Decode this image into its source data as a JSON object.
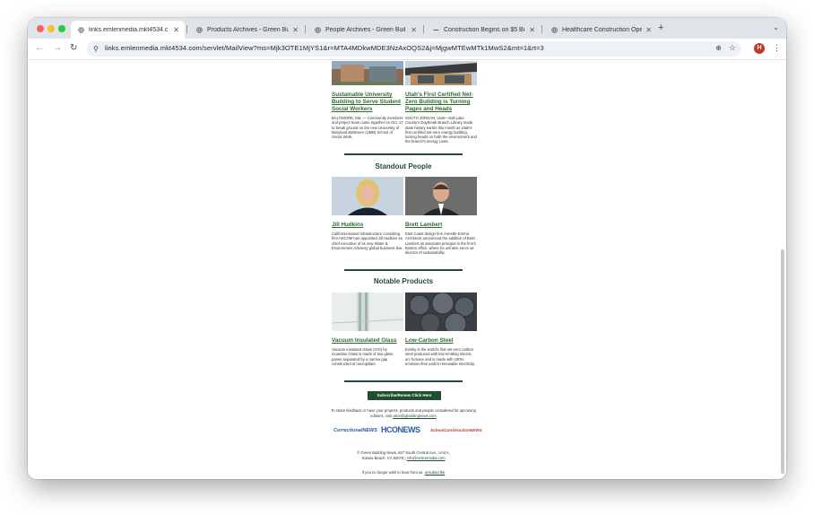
{
  "browser": {
    "tabs": [
      {
        "title": "links.emlenmedia.mkt4534.c",
        "active": true
      },
      {
        "title": "Products Archives - Green Bu",
        "active": false
      },
      {
        "title": "People Archives - Green Buil",
        "active": false
      },
      {
        "title": "Construction Begins on $5 Bi",
        "active": false
      },
      {
        "title": "Healthcare Construction Ope",
        "active": false
      }
    ],
    "new_tab": "+",
    "url": "links.emlenmedia.mkt4534.com/servlet/MailView?ms=Mjk3OTE1MjYS1&r=MTA4MDkwMDE3NzAxOQS2&j=MjgwMTEwMTk1MwS2&mt=1&rt=3",
    "avatar_letter": "H"
  },
  "email": {
    "projects": [
      {
        "title": "Sustainable University Building to Serve Student Social Workers",
        "body": "BALTIMORE, Md. — Community members and project team came together on Oct. 17 to break ground on the new University of Maryland Baltimore (UMB) School of Social Work."
      },
      {
        "title": "Utah's First Certified Net-Zero Building is Turning Pages and Heads",
        "body": "SOUTH JORDAN, Utah—Salt Lake County's Daybreak Branch Library made state history earlier this month as Utah's first certified net-zero energy building, turning heads on both the environment and the branch's energy costs."
      }
    ],
    "people_title": "Standout People",
    "people": [
      {
        "name": "Jill Hudkins",
        "body": "California-based infrastructure consulting firm AECOM has appointed Jill Hudkins as chief executive of its new Water & Environment Advisory global business line."
      },
      {
        "name": "Brett Lambert",
        "body": "East Coast design firm Annette-Emma Architects announced the addition of Brett Lambert as associate principal in the firm's Boston office, where he will also serve as director of sustainability."
      }
    ],
    "products_title": "Notable Products",
    "products": [
      {
        "name": "Vacuum Insulated Glass",
        "body": "Vacuum Insulated Glass (VIG) by Guardian Glass is made of two glass panes separated by a narrow gap constructed of micropillars."
      },
      {
        "name": "Low-Carbon Steel",
        "body": "Evinity is the world's first net-zero carbon steel produced with low-emitting electric arc furnace and is made with 100% emission-free and/or renewable electricity."
      }
    ],
    "subscribe_label": "Subscribe/Renew Click Here",
    "feedback_text": "To share feedback or have your projects, products and people considered for upcoming editions, visit",
    "feedback_link": "alice@gbuildingnews.com",
    "logos": [
      "CorrectionalNEWS",
      "HCONEWS",
      "SchoolConstructionNEWS"
    ],
    "address_line1": "© Green Building News, 827 South Central Ave., Unit A,",
    "address_line2": "Solana Beach, CA 92075 |",
    "address_link": "info@emlenmedia.com",
    "unsub_text": "If you no longer wish to hear from us,",
    "unsub_link": "unsubscribe"
  }
}
